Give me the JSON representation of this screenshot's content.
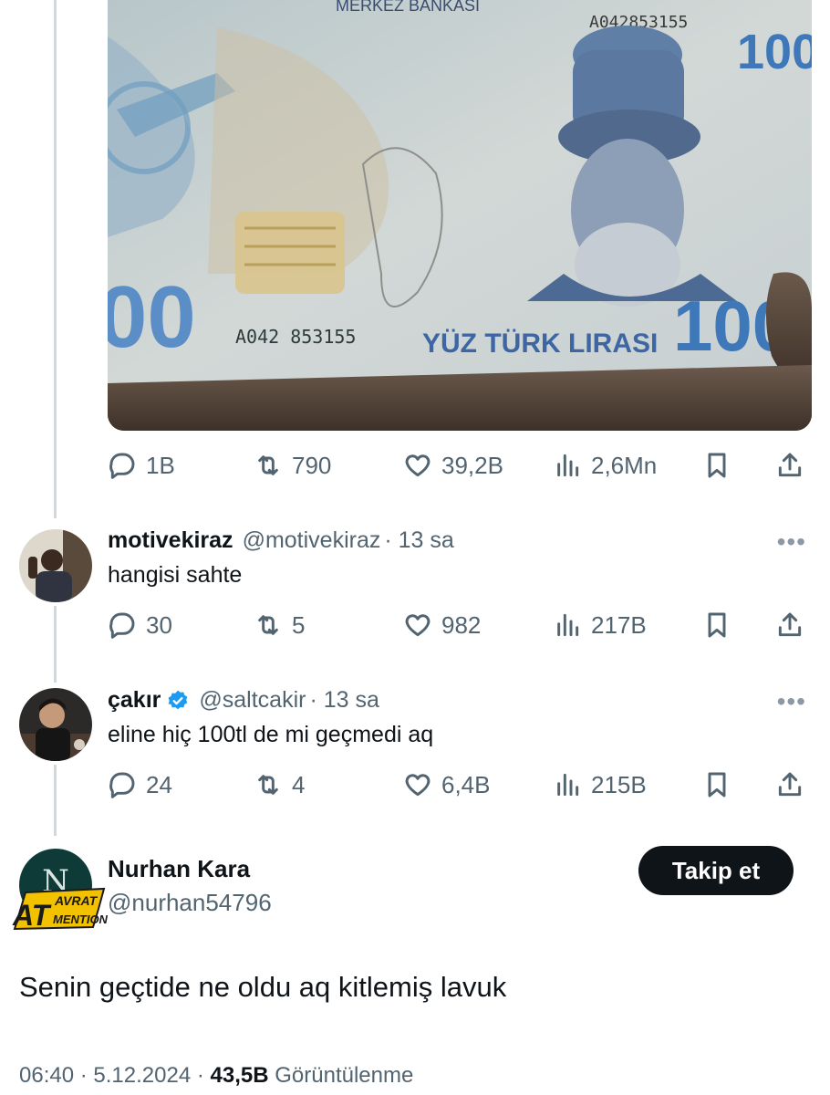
{
  "quoted_tweet": {
    "image": {
      "bank_text": "MERKEZ BANKASI",
      "serial_top": "A042853155",
      "serial_bottom": "A042853155",
      "denomination_text": "YÜZ TÜRK LIRASI",
      "value": "100",
      "portrait": "Itri"
    },
    "stats": {
      "replies": "1B",
      "retweets": "790",
      "likes": "39,2B",
      "views": "2,6Mn"
    }
  },
  "replies": [
    {
      "name": "motivekiraz",
      "handle": "@motivekiraz",
      "time": "· 13 sa",
      "verified": false,
      "text": "hangisi sahte",
      "stats": {
        "replies": "30",
        "retweets": "5",
        "likes": "982",
        "views": "217B"
      }
    },
    {
      "name": "çakır",
      "handle": "@saltcakir",
      "time": "· 13 sa",
      "verified": true,
      "text": "eline hiç 100tl de mi geçmedi aq",
      "stats": {
        "replies": "24",
        "retweets": "4",
        "likes": "6,4B",
        "views": "215B"
      }
    }
  ],
  "main_tweet": {
    "avatar_initial": "N",
    "badge_text_big": "AT",
    "badge_text_top": "AVRAT",
    "badge_text_bottom": "MENTION",
    "name": "Nurhan Kara",
    "handle": "@nurhan54796",
    "follow_label": "Takip et",
    "text": "Senin geçtide ne oldu aq kitlemiş lavuk",
    "time": "06:40",
    "date": "5.12.2024",
    "views_count": "43,5B",
    "views_label": "Görüntülenme"
  },
  "colors": {
    "text": "#0f1419",
    "secondary": "#536471",
    "verified": "#1d9bf0",
    "thread_line": "#cfd9de"
  },
  "icons": [
    "reply-icon",
    "retweet-icon",
    "heart-icon",
    "views-icon",
    "bookmark-icon",
    "share-icon",
    "more-icon",
    "verified-icon"
  ]
}
